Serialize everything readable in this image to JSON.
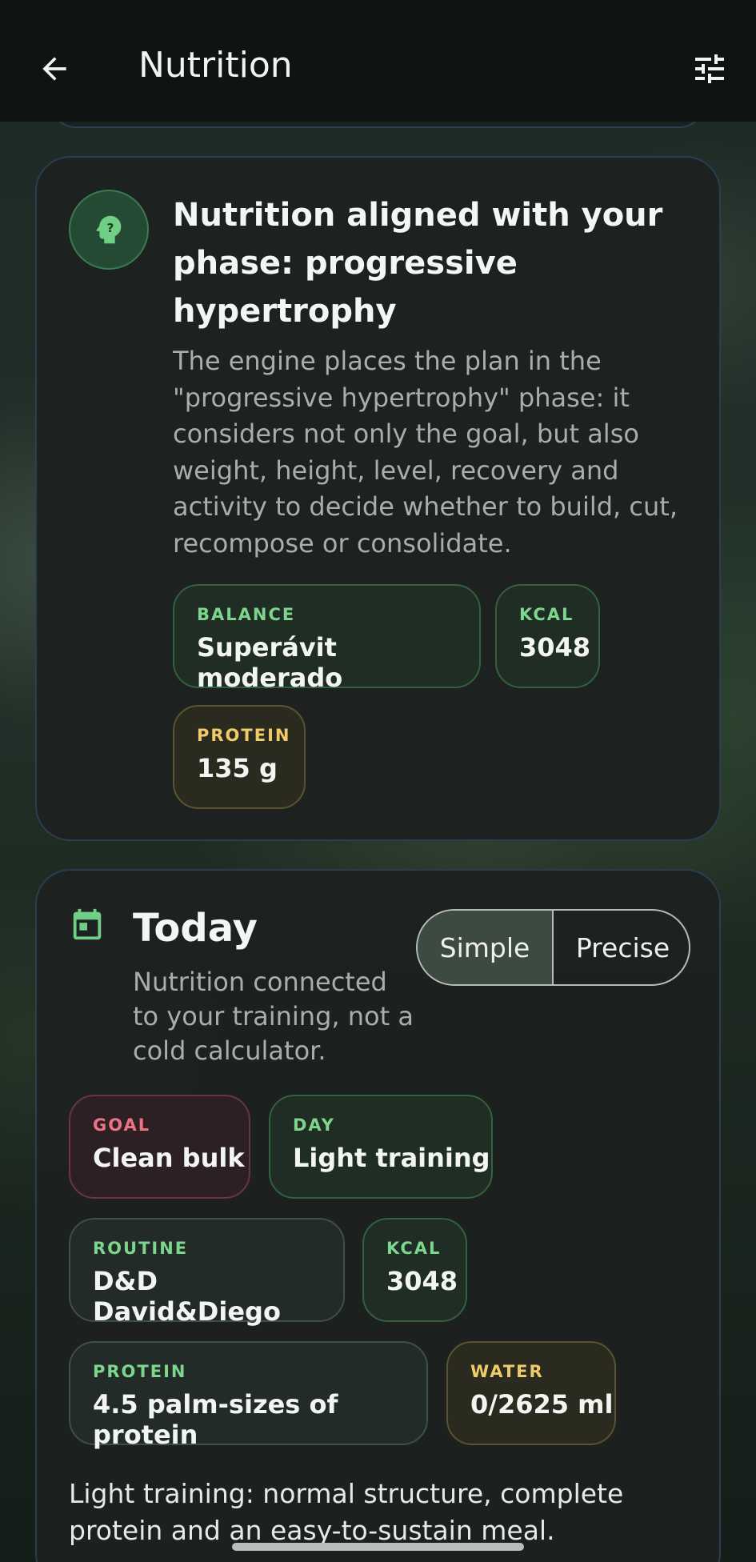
{
  "header": {
    "title": "Nutrition",
    "back_icon": "arrow-left-icon",
    "filter_icon": "sliders-icon"
  },
  "phase_card": {
    "icon": "help-head-icon",
    "title": "Nutrition aligned with your phase: progressive hypertrophy",
    "description": "The engine places the plan in the \"progressive hypertrophy\" phase: it considers not only the goal, but also weight, height, level, recovery and activity to decide whether to build, cut, recompose or consolidate.",
    "chips": {
      "balance": {
        "label": "BALANCE",
        "value": "Superávit moderado"
      },
      "kcal": {
        "label": "KCAL",
        "value": "3048"
      },
      "protein": {
        "label": "PROTEIN",
        "value": "135 g"
      }
    }
  },
  "today_card": {
    "icon": "calendar-icon",
    "title": "Today",
    "subtitle": "Nutrition connected to your training, not a cold calculator.",
    "mode": {
      "options": [
        "Simple",
        "Precise"
      ],
      "selected": "Simple"
    },
    "chips": {
      "goal": {
        "label": "GOAL",
        "value": "Clean bulk"
      },
      "day": {
        "label": "DAY",
        "value": "Light training"
      },
      "routine": {
        "label": "ROUTINE",
        "value": "D&D David&Diego"
      },
      "kcal": {
        "label": "KCAL",
        "value": "3048"
      },
      "protein": {
        "label": "PROTEIN",
        "value": "4.5 palm-sizes of protein"
      },
      "water": {
        "label": "WATER",
        "value": "0/2625 ml"
      }
    },
    "note": "Light training: normal structure, complete protein and an easy-to-sustain meal."
  },
  "colors": {
    "accent_green": "#7dd58e",
    "accent_yellow": "#efcb6a",
    "accent_red": "#ee7283",
    "card_border": "#2b3d50"
  }
}
